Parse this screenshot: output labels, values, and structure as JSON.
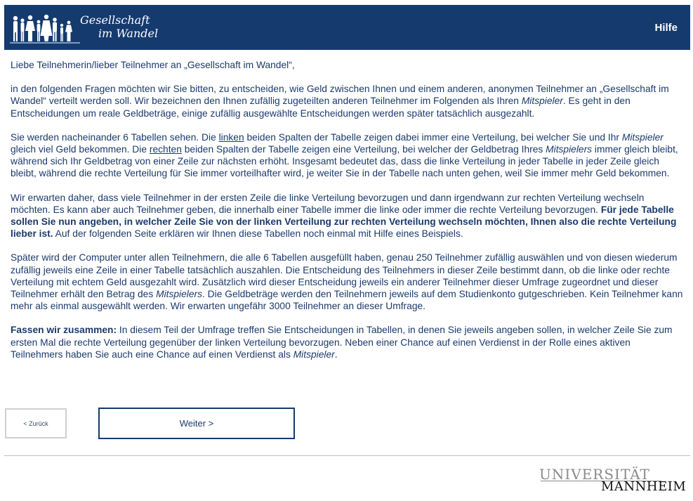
{
  "header": {
    "logo_line1": "Gesellschaft",
    "logo_line2": "im Wandel",
    "help_label": "Hilfe"
  },
  "content": {
    "greeting": "Liebe Teilnehmerin/lieber Teilnehmer an „Gesellschaft im Wandel“,",
    "p1": {
      "a": "in den folgenden Fragen möchten wir Sie bitten, zu entscheiden, wie Geld zwischen Ihnen und einem anderen, anonymen Teilnehmer an „Gesellschaft im Wandel“ verteilt werden soll. Wir bezeichnen den Ihnen zufällig zugeteilten anderen Teilnehmer im Folgenden als Ihren ",
      "b": "Mitspieler",
      "c": ". Es geht in den Entscheidungen um reale Geldbeträge, einige zufällig ausgewählte Entscheidungen werden später tatsächlich ausgezahlt."
    },
    "p2": {
      "a": "Sie werden nacheinander 6 Tabellen sehen. Die ",
      "b": "linken",
      "c": " beiden Spalten der Tabelle zeigen dabei immer eine Verteilung, bei welcher Sie und Ihr ",
      "d": "Mitspieler",
      "e": " gleich viel Geld bekommen. Die ",
      "f": "rechten",
      "g": " beiden Spalten der Tabelle zeigen eine Verteilung, bei welcher der Geldbetrag Ihres ",
      "h": "Mitspielers",
      "i": " immer gleich bleibt, während sich Ihr Geldbetrag von einer Zeile zur nächsten erhöht. Insgesamt bedeutet das, dass die linke Verteilung in jeder Tabelle in jeder Zeile gleich bleibt, während die rechte Verteilung für Sie immer vorteilhafter wird, je weiter Sie in der Tabelle nach unten gehen, weil Sie immer mehr Geld bekommen."
    },
    "p3": {
      "a": "Wir erwarten daher, dass viele Teilnehmer in der ersten Zeile die linke Verteilung bevorzugen und dann irgendwann zur rechten Verteilung wechseln möchten. Es kann aber auch Teilnehmer geben, die innerhalb einer Tabelle immer die linke oder immer die rechte Verteilung bevorzugen. ",
      "b": "Für jede Tabelle sollen Sie nun angeben, in welcher Zeile Sie von der linken Verteilung zur rechten Verteilung wechseln möchten, Ihnen also die rechte Verteilung lieber ist.",
      "c": " Auf der folgenden Seite erklären wir Ihnen diese Tabellen noch einmal mit Hilfe eines Beispiels."
    },
    "p4": {
      "a": "Später wird der Computer unter allen Teilnehmern, die alle 6 Tabellen ausgefüllt haben, genau 250 Teilnehmer zufällig auswählen und von diesen wiederum zufällig jeweils eine Zeile in einer Tabelle tatsächlich auszahlen. Die Entscheidung des Teilnehmers in dieser Zeile bestimmt dann, ob die linke oder rechte Verteilung mit echtem Geld ausgezahlt wird. Zusätzlich wird dieser Entscheidung jeweils ein anderer Teilnehmer dieser Umfrage zugeordnet und dieser Teilnehmer erhält den Betrag des ",
      "b": "Mitspielers",
      "c": ". Die Geldbeträge werden den Teilnehmern jeweils auf dem Studienkonto gutgeschrieben. Kein Teilnehmer kann mehr als einmal ausgewählt werden. Wir erwarten ungefähr 3000 Teilnehmer an dieser Umfrage."
    },
    "p5": {
      "a": "Fassen wir zusammen:",
      "b": " In diesem Teil der Umfrage treffen Sie Entscheidungen in Tabellen, in denen Sie jeweils angeben sollen, in welcher Zeile Sie zum ersten Mal die rechte Verteilung gegenüber der linken Verteilung bevorzugen. Neben einer Chance auf einen Verdienst in der Rolle eines aktiven Teilnehmers haben Sie auch eine Chance auf einen Verdienst als ",
      "c": "Mitspieler",
      "d": "."
    }
  },
  "nav": {
    "back_label": "< Zurück",
    "next_label": "Weiter >"
  },
  "footer": {
    "uni_line1": "UNIVERSITÄT",
    "uni_line2": "MANNHEIM"
  },
  "colors": {
    "header_bg": "#153a6e",
    "text": "#1b3a6b"
  },
  "icons": {
    "logo_art": "people-silhouettes-icon"
  }
}
